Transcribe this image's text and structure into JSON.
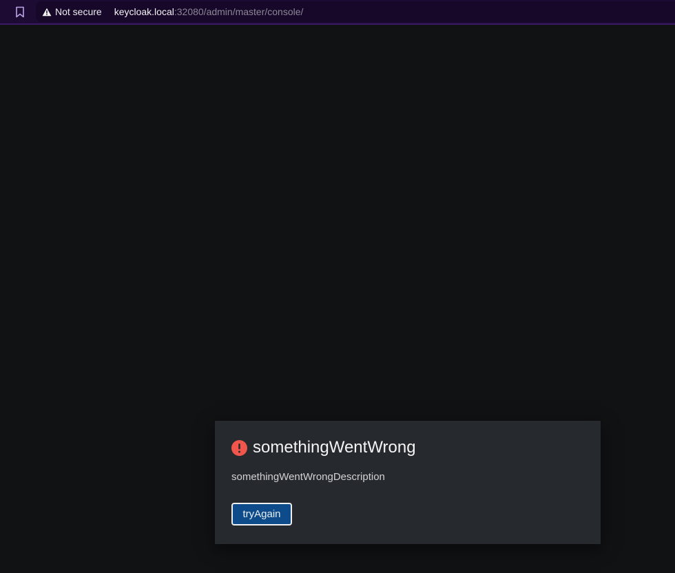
{
  "browser": {
    "security_label": "Not secure",
    "url_host": "keycloak.local",
    "url_rest": ":32080/admin/master/console/",
    "icons": {
      "bookmark": "bookmark-icon",
      "security": "warning-triangle-icon"
    }
  },
  "alert": {
    "icon": "exclamation-circle-icon",
    "title": "somethingWentWrong",
    "description": "somethingWentWrongDescription",
    "button_label": "tryAgain"
  },
  "colors": {
    "background": "#111214",
    "browser_bar": "#1e0b33",
    "alert_background": "#26292d",
    "danger": "#f0564c",
    "button_primary": "#0d4b8a"
  }
}
